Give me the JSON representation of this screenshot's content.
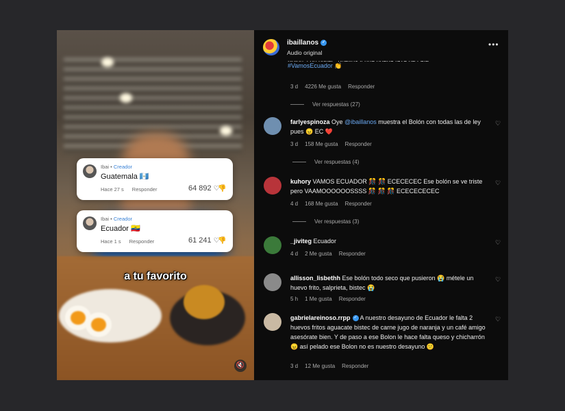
{
  "video": {
    "cards": [
      {
        "user": "Ibai",
        "role": "Creador",
        "text": "Guatemala",
        "flag": "🇬🇹",
        "time": "Hace 27 s",
        "reply": "Responder",
        "likes": "64 892"
      },
      {
        "user": "Ibai",
        "role": "Creador",
        "text": "Ecuador",
        "flag": "🇪🇨",
        "time": "Hace 1 s",
        "reply": "Responder",
        "likes": "61 241"
      }
    ],
    "caption": "a tu favorito",
    "mute_icon": "🔇"
  },
  "post": {
    "username": "ibaillanos",
    "subtitle": "Audio original",
    "more": "•••",
    "top_comment_cut": "Bolón, con bistec, huevos y una buena taza de café.",
    "top_comment_tag": "#VamosEcuador",
    "top_comment_emoji": "👏",
    "top_meta": {
      "time": "3 d",
      "likes": "4226 Me gusta",
      "reply": "Responder"
    },
    "top_view_replies": "Ver respuestas (27)"
  },
  "comments": [
    {
      "user": "farlyespinoza",
      "pre": "Oye ",
      "mention": "@ibaillanos",
      "text": " muestra el Bolón con todas las de ley pues 😠 EC ❤️",
      "time": "3 d",
      "likes": "158 Me gusta",
      "reply": "Responder",
      "view_replies": "Ver respuestas (4)",
      "avatar_color": "#6f8fb0"
    },
    {
      "user": "kuhory",
      "pre": "",
      "mention": "",
      "text": "VAMOS ECUADOR 🎊 🎊 ECECECEC Ese bolón se ve triste pero VAAMOOOOOOSSSS 🎊 🎊 🎊 ECECECECEC",
      "time": "4 d",
      "likes": "168 Me gusta",
      "reply": "Responder",
      "view_replies": "Ver respuestas (3)",
      "avatar_color": "#b8343a"
    },
    {
      "user": "_jiviteg",
      "pre": "",
      "mention": "",
      "text": "Ecuador",
      "time": "4 d",
      "likes": "2 Me gusta",
      "reply": "Responder",
      "view_replies": "",
      "avatar_color": "#3b7a3a"
    },
    {
      "user": "allisson_lisbethh",
      "pre": "",
      "mention": "",
      "text": "Ese bolón todo seco que pusieron 😭 métele un huevo frito, salprieta, bistec 😭",
      "time": "5 h",
      "likes": "1 Me gusta",
      "reply": "Responder",
      "view_replies": "",
      "avatar_color": "#8a8a8a"
    },
    {
      "user": "gabrielareinoso.rrpp",
      "pre": "",
      "mention": "",
      "text": "A nuestro desayuno de Ecuador le falta 2 huevos fritos aguacate bistec de carne jugo de naranja y un café amigo asesórate bien. Y de paso a ese Bolon le hace falta queso y chicharrón 😠 así pelado ese Bolon no es nuestro desayuno 😕",
      "time": "3 d",
      "likes": "12 Me gusta",
      "reply": "Responder",
      "view_replies": "",
      "avatar_color": "#c9b9a3"
    }
  ]
}
